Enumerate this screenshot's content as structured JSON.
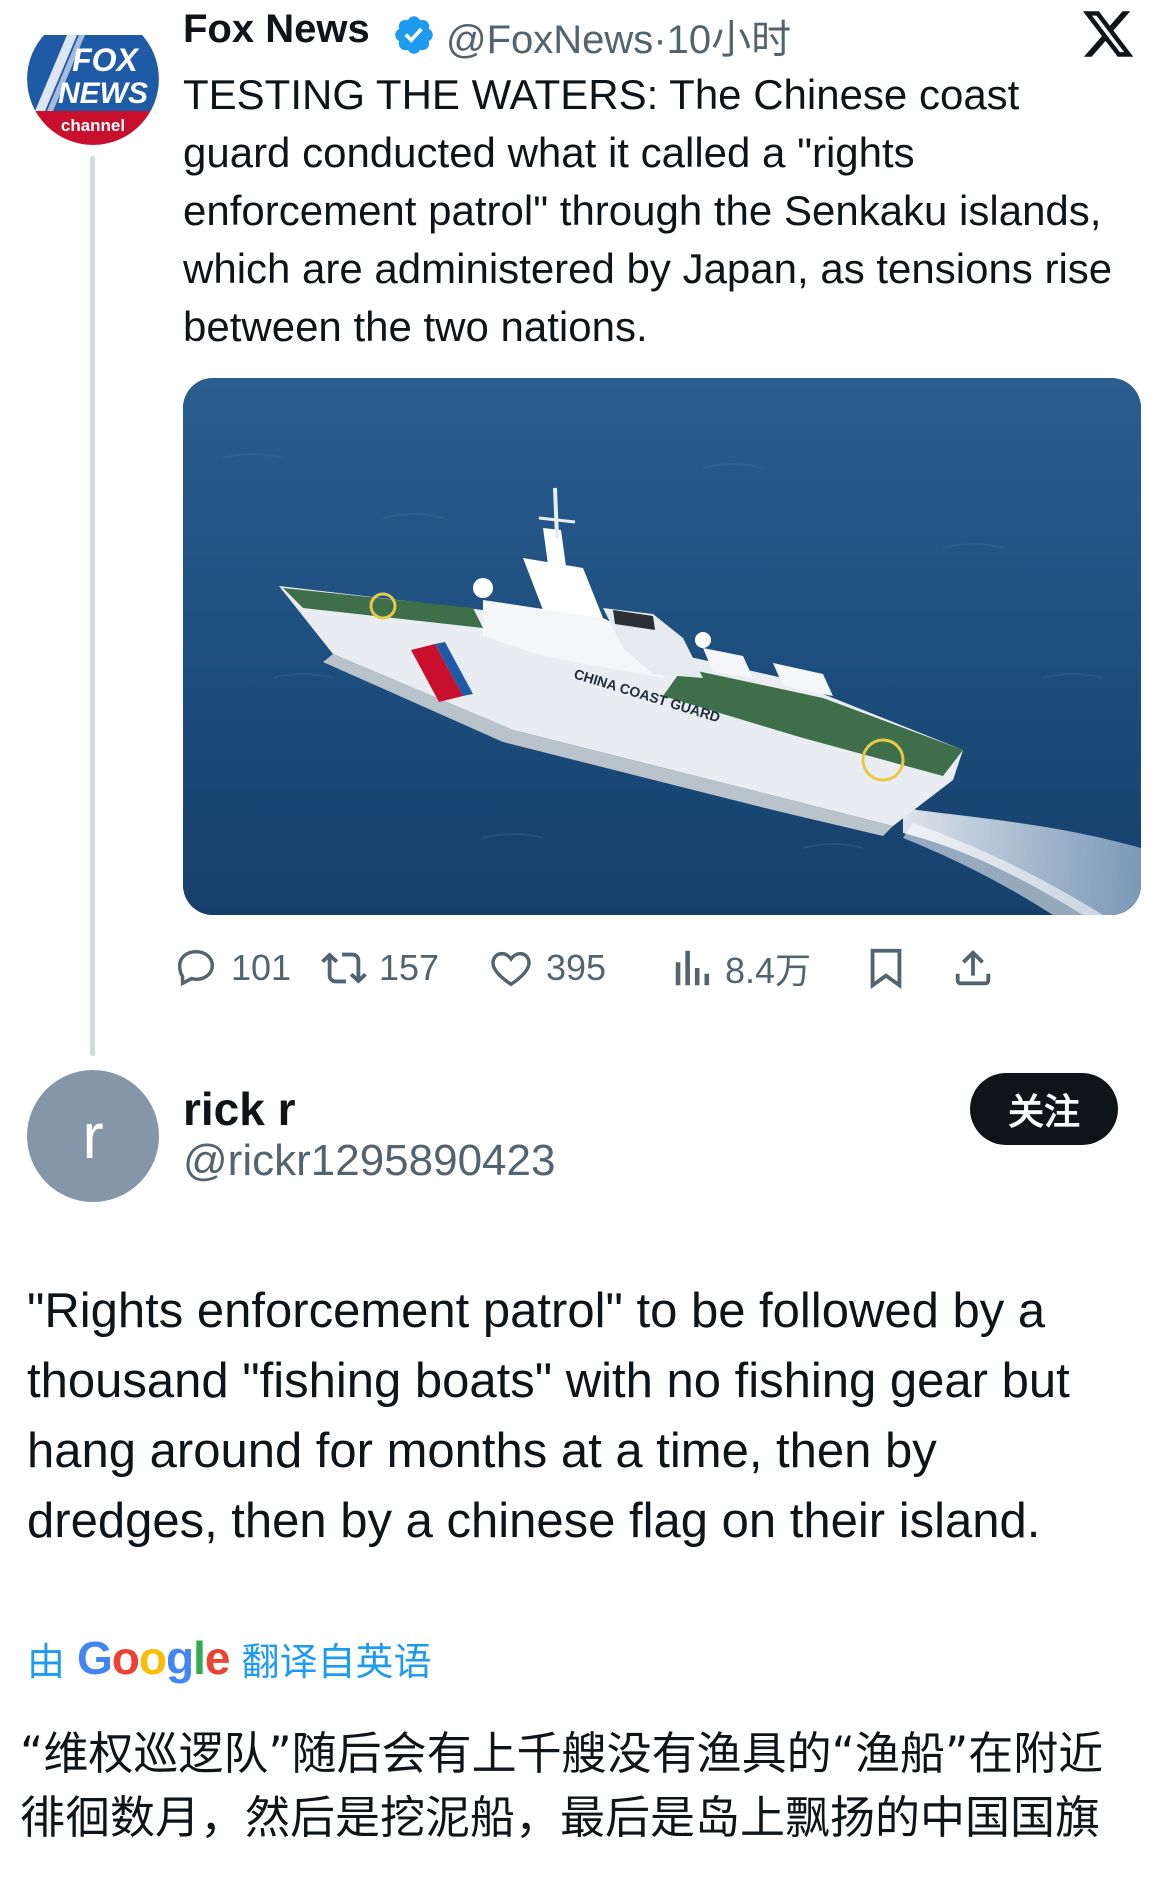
{
  "post": {
    "author_name": "Fox News",
    "author_handle": "@FoxNews",
    "time": "·10小时",
    "text": "TESTING THE WATERS: The Chinese coast guard conducted what it called a \"rights enforcement patrol\" through the Senkaku islands, which are administered by Japan, as tensions rise between the two nations.",
    "avatar": {
      "line1": "FOX",
      "line2": "NEWS",
      "line3": "channel"
    },
    "media_ship_text": "CHINA COAST GUARD",
    "stats": {
      "replies": "101",
      "reposts": "157",
      "likes": "395",
      "views": "8.4万"
    }
  },
  "reply": {
    "avatar_letter": "r",
    "name": "rick r",
    "handle": "@rickr1295890423",
    "follow_label": "关注",
    "text": "\"Rights enforcement patrol\" to be followed by a thousand \"fishing boats\" with no fishing gear but hang around for months at a time, then by dredges, then by a chinese flag on their island."
  },
  "translation": {
    "prefix": "由",
    "brand_letters": [
      {
        "ch": "G",
        "color": "#4285f4"
      },
      {
        "ch": "o",
        "color": "#ea4335"
      },
      {
        "ch": "o",
        "color": "#fbbc05"
      },
      {
        "ch": "g",
        "color": "#4285f4"
      },
      {
        "ch": "l",
        "color": "#34a853"
      },
      {
        "ch": "e",
        "color": "#ea4335"
      }
    ],
    "suffix": "翻译自英语",
    "text": "“维权巡逻队”随后会有上千艘没有渔具的“渔船”在附近徘徊数月，然后是挖泥船，最后是岛上飘扬的中国国旗"
  },
  "colors": {
    "text_primary": "#0f1419",
    "text_secondary": "#536471",
    "verified_blue": "#1d9bf0",
    "link_blue": "#1d9bf0",
    "avatar_gray": "#8496a8",
    "fox_blue": "#1f5aa6",
    "fox_red": "#c8102e"
  },
  "icons": [
    "verified-badge-icon",
    "x-logo-icon",
    "reply-icon",
    "repost-icon",
    "like-icon",
    "views-icon",
    "bookmark-icon",
    "share-icon"
  ]
}
